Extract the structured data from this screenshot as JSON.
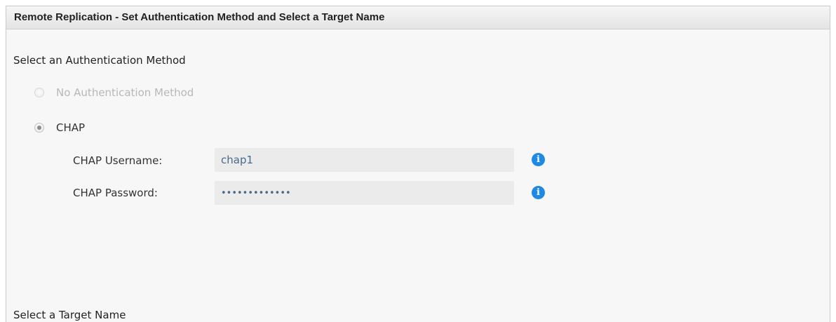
{
  "header": {
    "title": "Remote Replication - Set Authentication Method and Select a Target Name"
  },
  "auth_section": {
    "title": "Select an Authentication Method",
    "options": [
      {
        "label": "No Authentication Method",
        "selected": false,
        "disabled": true
      },
      {
        "label": "CHAP",
        "selected": true,
        "disabled": false
      }
    ]
  },
  "chap": {
    "username_label": "CHAP Username:",
    "username_value": "chap1",
    "password_label": "CHAP Password:",
    "password_value": "•••••••••••••",
    "info_icon": "info-icon"
  },
  "target_section": {
    "title": "Select a Target Name"
  },
  "colors": {
    "info_icon": "#1e8ae6",
    "input_bg": "#ebebeb",
    "panel_bg": "#f7f7f7"
  }
}
